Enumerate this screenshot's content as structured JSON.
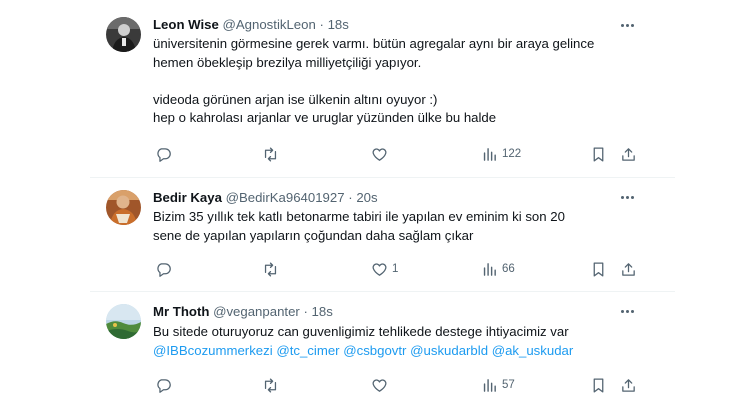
{
  "tweets": [
    {
      "name": "Leon Wise",
      "handle": "@AgnostikLeon",
      "separator": "·",
      "time": "18s",
      "body_lines": [
        "üniversitenin görmesine gerek varmı.  bütün agregalar aynı bir araya gelince",
        "hemen öbekleşip brezilya milliyetçiliği yapıyor.",
        "",
        "videoda görünen arjan ise ülkenin altını oyuyor :)",
        "hep o kahrolası arjanlar ve uruglar yüzünden ülke bu halde"
      ],
      "stats": {
        "replies": "",
        "retweets": "",
        "likes": "",
        "views": "122"
      },
      "avatar_icon": "person-dark-avatar"
    },
    {
      "name": "Bedir Kaya",
      "handle": "@BedirKa96401927",
      "separator": "·",
      "time": "20s",
      "body_lines": [
        "Bizim 35 yıllık tek katlı betonarme tabiri ile yapılan ev eminim ki son 20",
        "sene de yapılan yapıların çoğundan daha sağlam çıkar"
      ],
      "stats": {
        "replies": "",
        "retweets": "",
        "likes": "1",
        "views": "66"
      },
      "avatar_icon": "person-orange-avatar"
    },
    {
      "name": "Mr Thoth",
      "handle": "@veganpanter",
      "separator": "·",
      "time": "18s",
      "body_lines": [
        "Bu sitede oturuyoruz can guvenligimiz tehlikede destege ihtiyacimiz var"
      ],
      "mentions": [
        "@IBBcozummerkezi",
        "@tc_cimer",
        "@csbgovtr",
        "@uskudarbld",
        "@ak_uskudar"
      ],
      "stats": {
        "replies": "",
        "retweets": "",
        "likes": "",
        "views": "57"
      },
      "avatar_icon": "landscape-avatar"
    }
  ],
  "icons": {
    "reply": "reply-icon",
    "retweet": "retweet-icon",
    "like": "heart-icon",
    "views": "views-icon",
    "bookmark": "bookmark-icon",
    "share": "share-icon",
    "more": "more-icon"
  },
  "colors": {
    "text": "#0f1419",
    "secondary": "#536471",
    "link": "#1d9bf0",
    "divider": "#eff3f4"
  }
}
